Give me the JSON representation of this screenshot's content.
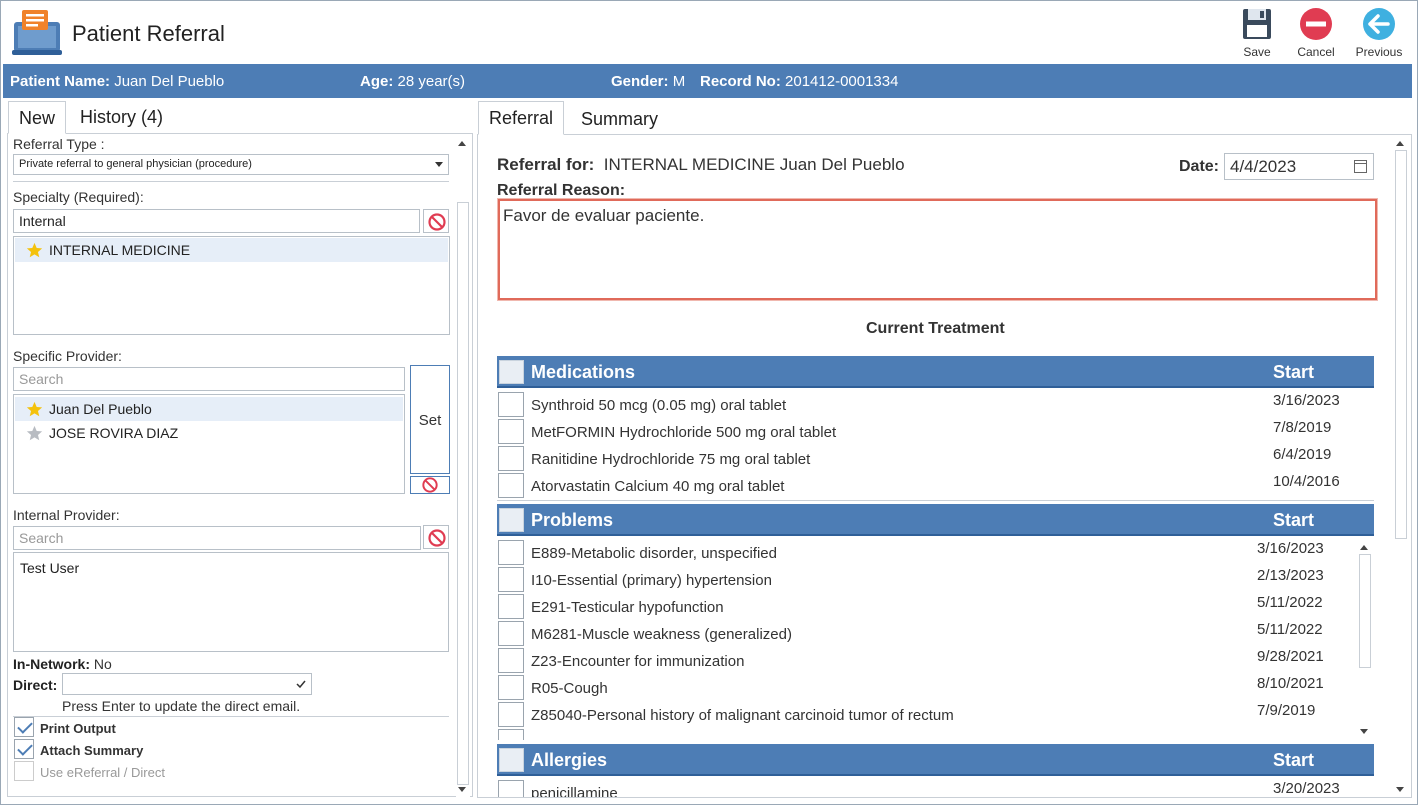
{
  "window": {
    "title": "Patient Referral"
  },
  "toolbar": {
    "save_label": "Save",
    "cancel_label": "Cancel",
    "previous_label": "Previous"
  },
  "patient": {
    "name_label": "Patient Name:",
    "name": "Juan Del Pueblo",
    "age_label": "Age:",
    "age": "28 year(s)",
    "gender_label": "Gender:",
    "gender": "M",
    "record_label": "Record No:",
    "record": "201412-0001334"
  },
  "left": {
    "tabs": [
      {
        "label": "New"
      },
      {
        "label": "History (4)"
      }
    ],
    "referral_type_label": "Referral Type :",
    "referral_type_value": "Private referral to general physician (procedure)",
    "specialty_label": "Specialty (Required):",
    "specialty_input": "Internal",
    "specialty_items": [
      {
        "label": "INTERNAL MEDICINE"
      }
    ],
    "provider_label": "Specific Provider:",
    "provider_search_placeholder": "Search",
    "provider_items": [
      {
        "label": "Juan  Del Pueblo"
      },
      {
        "label": "JOSE ROVIRA DIAZ"
      }
    ],
    "set_label": "Set",
    "internal_label": "Internal Provider:",
    "internal_search_placeholder": "Search",
    "internal_items": [
      {
        "label": "Test User"
      }
    ],
    "in_network_label": "In-Network:",
    "in_network_value": "No",
    "direct_label": "Direct:",
    "direct_hint": "Press Enter to update the direct email.",
    "print_output_label": "Print Output",
    "attach_summary_label": "Attach Summary",
    "ereferral_label": "Use eReferral / Direct"
  },
  "right": {
    "tabs": [
      {
        "label": "Referral"
      },
      {
        "label": "Summary"
      }
    ],
    "referral_for_label": "Referral for:",
    "referral_for_value": "INTERNAL MEDICINE Juan  Del Pueblo",
    "date_label": "Date:",
    "date_value": "4/4/2023",
    "reason_label": "Referral Reason:",
    "reason_text": "Favor de evaluar paciente.",
    "current_treatment_label": "Current Treatment",
    "medications": {
      "title": "Medications",
      "start_label": "Start",
      "rows": [
        {
          "name": "Synthroid 50 mcg (0.05 mg) oral tablet",
          "start": "3/16/2023"
        },
        {
          "name": "MetFORMIN Hydrochloride 500 mg oral tablet",
          "start": "7/8/2019"
        },
        {
          "name": "Ranitidine Hydrochloride 75 mg oral tablet",
          "start": "6/4/2019"
        },
        {
          "name": "Atorvastatin Calcium 40 mg oral tablet",
          "start": "10/4/2016"
        }
      ]
    },
    "problems": {
      "title": "Problems",
      "start_label": "Start",
      "rows": [
        {
          "name": "E889-Metabolic disorder, unspecified",
          "start": "3/16/2023"
        },
        {
          "name": "I10-Essential (primary) hypertension",
          "start": "2/13/2023"
        },
        {
          "name": "E291-Testicular hypofunction",
          "start": "5/11/2022"
        },
        {
          "name": "M6281-Muscle weakness (generalized)",
          "start": "5/11/2022"
        },
        {
          "name": "Z23-Encounter for immunization",
          "start": "9/28/2021"
        },
        {
          "name": "R05-Cough",
          "start": "8/10/2021"
        },
        {
          "name": "Z85040-Personal history of malignant carcinoid tumor of rectum",
          "start": "7/9/2019"
        }
      ]
    },
    "allergies": {
      "title": "Allergies",
      "start_label": "Start",
      "rows": [
        {
          "name": "penicillamine",
          "start": "3/20/2023"
        }
      ]
    }
  },
  "colors": {
    "banner": "#4d7db5",
    "accent": "#4d7db5",
    "danger": "#e03c52",
    "highlight": "#e06a5a"
  }
}
